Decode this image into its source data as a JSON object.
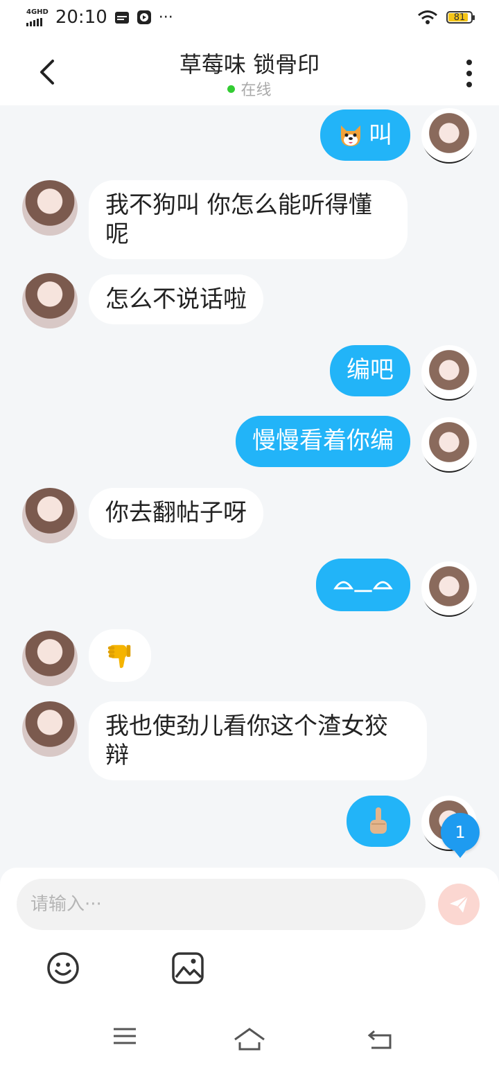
{
  "status_bar": {
    "network": "4GHD",
    "time": "20:10",
    "more": "···",
    "battery_level": "81",
    "battery_color": "#f5c518"
  },
  "header": {
    "title": "草莓味 锁骨印",
    "presence": "在线",
    "presence_color": "#33cc33"
  },
  "messages": [
    {
      "side": "out",
      "text": "叫",
      "emoji": "dog-face"
    },
    {
      "side": "in",
      "text": "我不狗叫 你怎么能听得懂呢"
    },
    {
      "side": "in",
      "text": "怎么不说话啦"
    },
    {
      "side": "out",
      "text": "编吧"
    },
    {
      "side": "out",
      "text": "慢慢看着你编"
    },
    {
      "side": "in",
      "text": "你去翻帖子呀"
    },
    {
      "side": "out",
      "emoji": "smile-eyes-emoticon"
    },
    {
      "side": "in",
      "emoji": "thumbs-down"
    },
    {
      "side": "in",
      "text": "我也使劲儿看你这个渣女狡辩"
    },
    {
      "side": "out",
      "emoji": "middle-finger"
    }
  ],
  "new_message_badge": "1",
  "composer": {
    "placeholder": "请输入···",
    "value": "",
    "send_color": "#fbd7d1"
  },
  "colors": {
    "outgoing_bubble": "#22b4f8",
    "incoming_bubble": "#ffffff",
    "background": "#f4f6f8",
    "badge": "#1e9bf0"
  }
}
